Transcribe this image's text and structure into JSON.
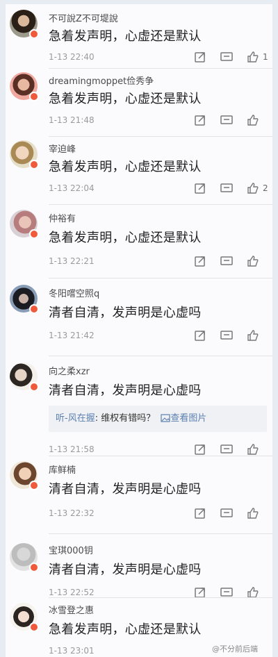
{
  "comments": [
    {
      "user": "不可說Z不可堤說",
      "text": "急着发声明，心虚还是默认",
      "time": "1-13 22:40",
      "likes": "1"
    },
    {
      "user": "dreamingmoppet俭秀争",
      "text": "急着发声明，心虚还是默认",
      "time": "1-13 21:48",
      "likes": ""
    },
    {
      "user": "宰迫峰",
      "text": "急着发声明，心虚还是默认",
      "time": "1-13 22:04",
      "likes": "2"
    },
    {
      "user": "仲裕有",
      "text": "急着发声明，心虚还是默认",
      "time": "1-13 22:21",
      "likes": ""
    },
    {
      "user": "冬阳嚐空照q",
      "text": "清者自清，发声明是心虚吗",
      "time": "1-13 21:42",
      "likes": ""
    },
    {
      "user": "向之柔xzr",
      "text": "清者自清，发声明是心虚吗",
      "time": "1-13 21:58",
      "likes": "",
      "quote": {
        "user": "听-风在握",
        "text": ": 维权有错吗？",
        "link": "查看图片"
      }
    },
    {
      "user": "库鲜楠",
      "text": "清者自清，发声明是心虚吗",
      "time": "1-13 22:32",
      "likes": ""
    },
    {
      "user": "宝琪000钥",
      "text": "清者自清，发声明是心虚吗",
      "time": "1-13 22:52",
      "likes": ""
    },
    {
      "user": "冰雪登之惠",
      "text": "急着发声明，心虚还是默认",
      "time": "1-13 23:01",
      "likes": ""
    }
  ],
  "watermark": "@不分前后端",
  "icons": {
    "repost": "share-icon",
    "comment": "comment-icon",
    "like": "thumbs-up-icon",
    "image": "image-icon"
  },
  "colors": {
    "badge": "#f05a3c",
    "link": "#5b7fb0",
    "background": "#fbfbfd"
  }
}
